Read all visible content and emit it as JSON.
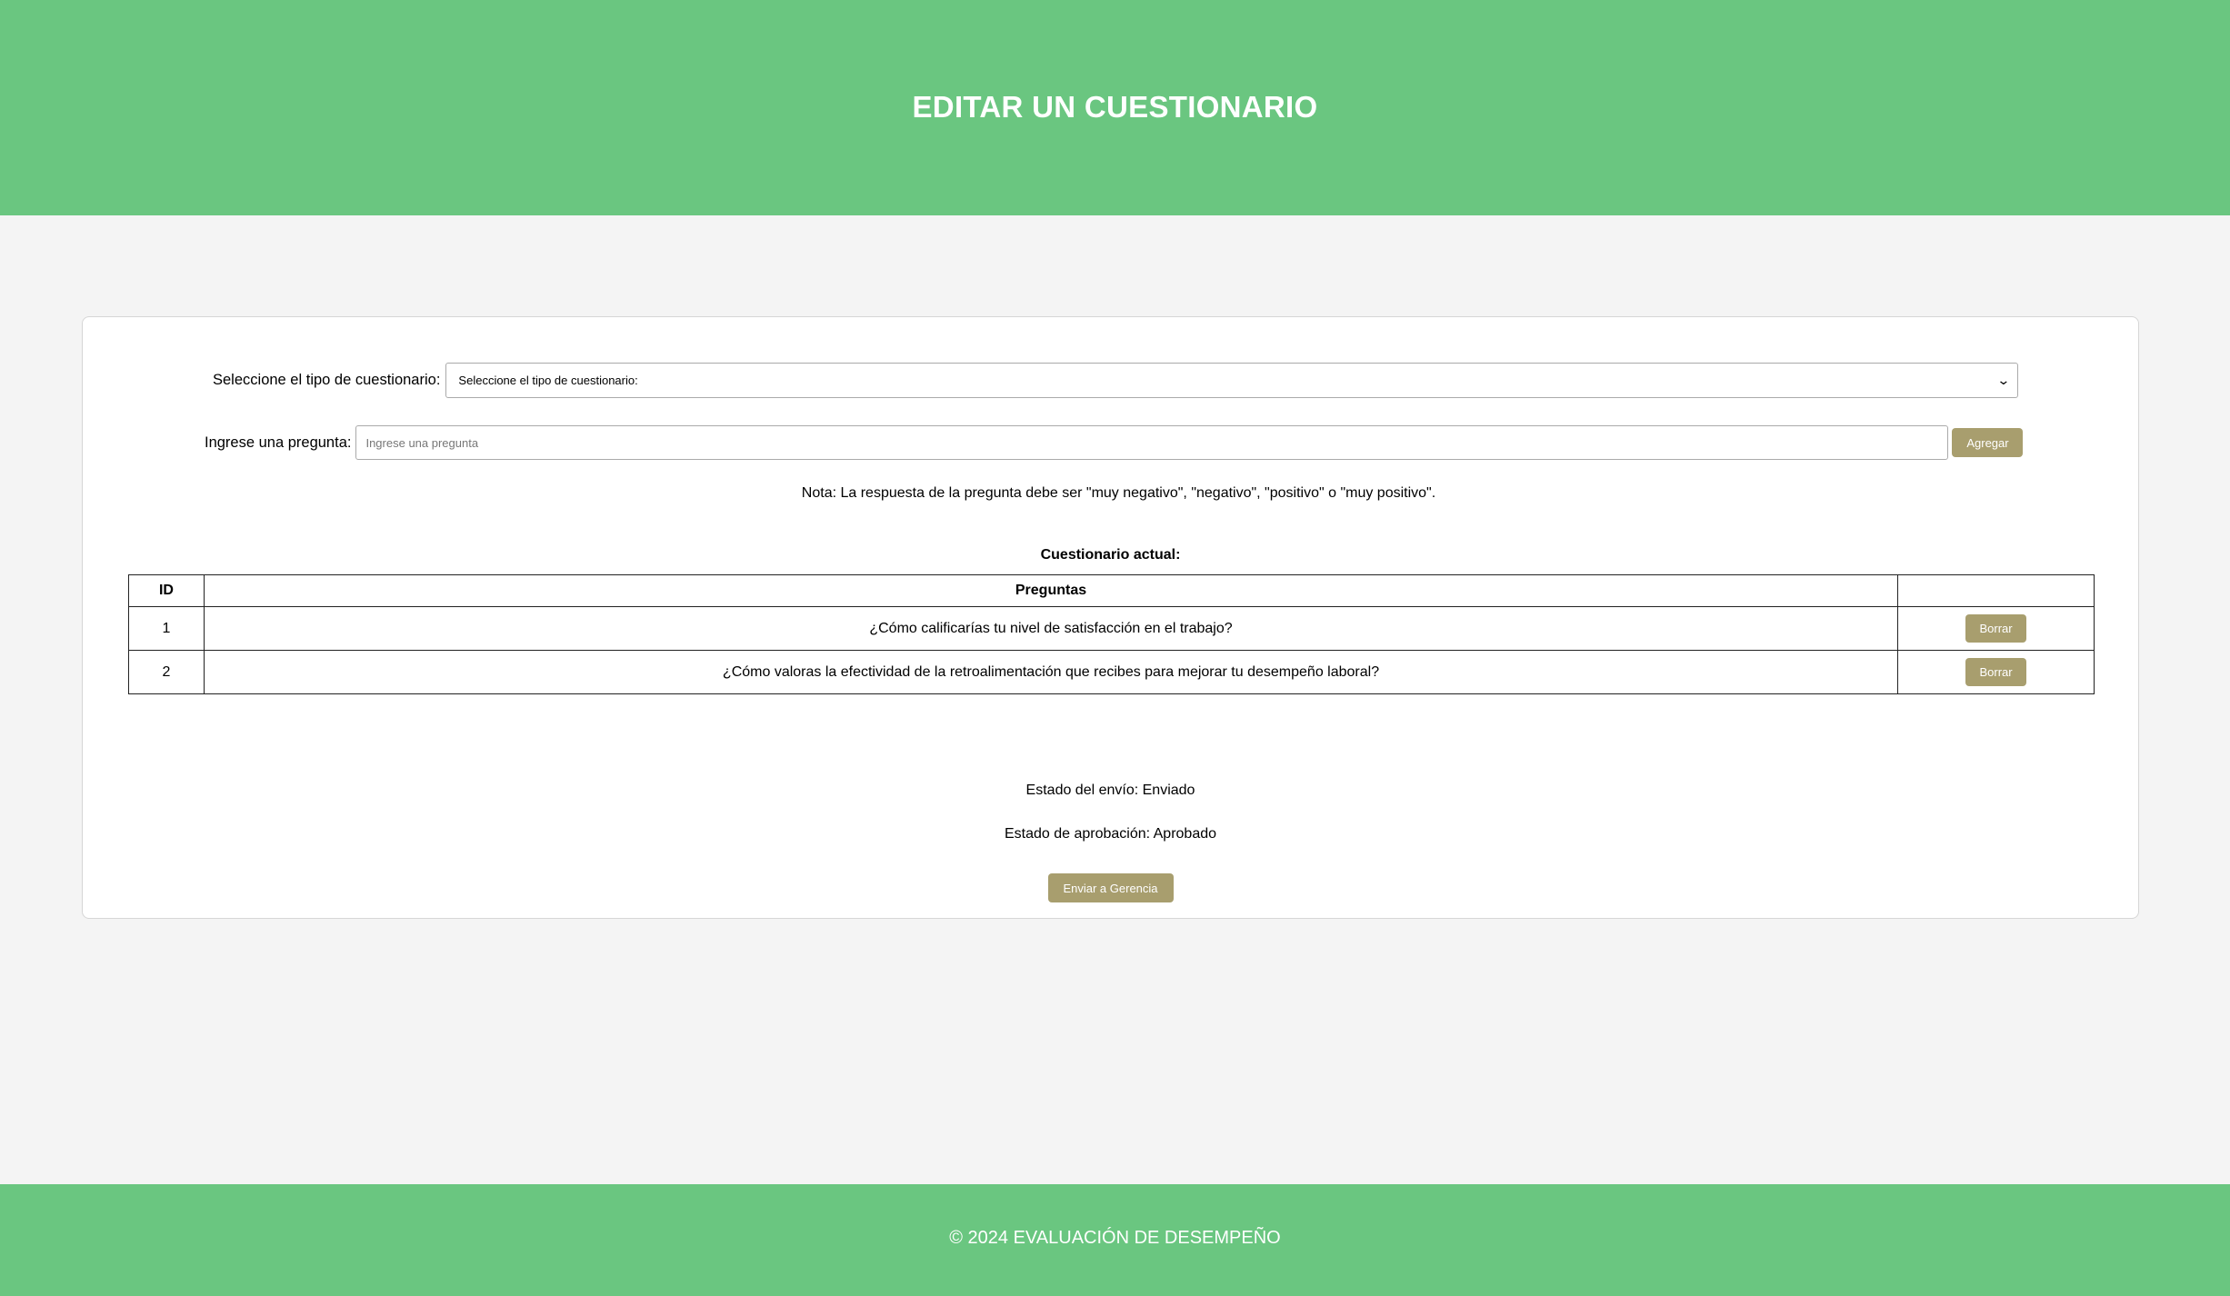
{
  "header": {
    "title": "EDITAR UN CUESTIONARIO"
  },
  "form": {
    "select_label": "Seleccione el tipo de cuestionario:",
    "select_value": "Seleccione el tipo de cuestionario:",
    "question_label": "Ingrese una pregunta:",
    "question_placeholder": "Ingrese una pregunta",
    "question_value": "",
    "add_button": "Agregar",
    "note": "Nota: La respuesta de la pregunta debe ser \"muy negativo\", \"negativo\", \"positivo\" o \"muy positivo\"."
  },
  "questionnaire": {
    "title": "Cuestionario actual:",
    "columns": {
      "id": "ID",
      "questions": "Preguntas",
      "actions": ""
    },
    "rows": [
      {
        "id": "1",
        "question": "¿Cómo calificarías tu nivel de satisfacción en el trabajo?",
        "action": "Borrar"
      },
      {
        "id": "2",
        "question": "¿Cómo valoras la efectividad de la retroalimentación que recibes para mejorar tu desempeño laboral?",
        "action": "Borrar"
      }
    ]
  },
  "status": {
    "send_status": "Estado del envío: Enviado",
    "approval_status": "Estado de aprobación: Aprobado",
    "send_button": "Enviar a Gerencia"
  },
  "footer": {
    "text": "© 2024 EVALUACIÓN DE DESEMPEÑO"
  },
  "colors": {
    "header_bg": "#6ac680",
    "button_bg": "#a89e6e",
    "page_bg": "#f4f4f4"
  },
  "icons": {
    "select_arrow": "chevron-down-icon"
  }
}
